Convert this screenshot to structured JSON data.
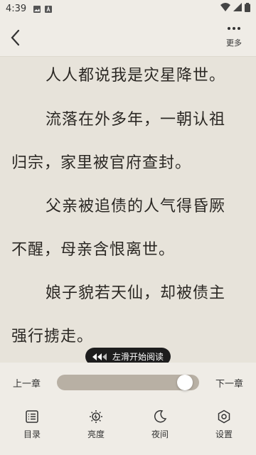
{
  "status_bar": {
    "time": "4:39"
  },
  "header": {
    "more_label": "更多"
  },
  "reader": {
    "paragraphs": [
      "人人都说我是灾星降世。",
      "流落在外多年，一朝认祖",
      "归宗，家里被官府查封。",
      "父亲被追债的人气得昏厥",
      "不醒，母亲含恨离世。",
      "娘子貌若天仙，却被债主",
      "强行掳走。"
    ]
  },
  "toast": {
    "text": "左滑开始阅读"
  },
  "chapter_nav": {
    "prev_label": "上一章",
    "next_label": "下一章",
    "progress": 0.95
  },
  "tabs": [
    {
      "label": "目录",
      "icon": "list-icon"
    },
    {
      "label": "亮度",
      "icon": "brightness-icon"
    },
    {
      "label": "夜间",
      "icon": "moon-icon"
    },
    {
      "label": "设置",
      "icon": "settings-icon"
    }
  ]
}
